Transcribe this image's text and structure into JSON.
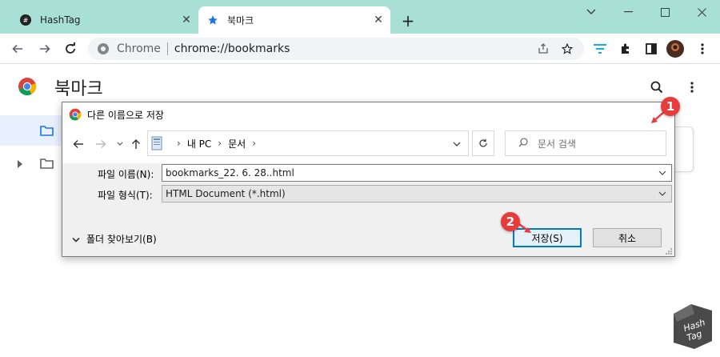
{
  "browser": {
    "tabs": [
      {
        "title": "HashTag",
        "active": false,
        "favicon": "hashtag-favicon-icon"
      },
      {
        "title": "북마크",
        "active": true,
        "favicon": "star-icon"
      }
    ],
    "url_chip": "Chrome",
    "url": "chrome://bookmarks"
  },
  "bookmarks_page": {
    "title": "북마크"
  },
  "save_dialog": {
    "title": "다른 이름으로 저장",
    "breadcrumb": [
      "내 PC",
      "문서"
    ],
    "search_placeholder": "문서 검색",
    "filename_label": "파일 이름(N):",
    "filename_value": "bookmarks_22. 6. 28..html",
    "filetype_label": "파일 형식(T):",
    "filetype_value": "HTML Document (*.html)",
    "browse_folders_label": "폴더 찾아보기(B)",
    "save_button": "저장(S)",
    "cancel_button": "취소"
  },
  "annotations": {
    "marker1": "1",
    "marker2": "2",
    "color": "#e83b3b"
  },
  "watermark": {
    "text_line1": "Hash",
    "text_line2": "Tag"
  },
  "colors": {
    "tabstrip": "#a8e0d6",
    "accent": "#1a73e8",
    "save_border": "#0078d7"
  }
}
